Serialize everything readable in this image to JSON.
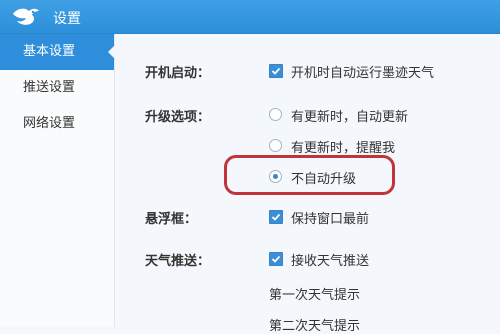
{
  "window": {
    "title": "设置",
    "logo": "bird-logo-icon"
  },
  "sidebar": {
    "items": [
      {
        "label": "基本设置",
        "active": true
      },
      {
        "label": "推送设置",
        "active": false
      },
      {
        "label": "网络设置",
        "active": false
      }
    ]
  },
  "settings": {
    "startup": {
      "label": "开机启动：",
      "option": {
        "text": "开机时自动运行墨迹天气",
        "checked": true
      }
    },
    "upgrade": {
      "label": "升级选项：",
      "options": [
        {
          "text": "有更新时，自动更新",
          "selected": false
        },
        {
          "text": "有更新时，提醒我",
          "selected": false
        },
        {
          "text": "不自动升级",
          "selected": true
        }
      ]
    },
    "floating": {
      "label": "悬浮框：",
      "option": {
        "text": "保持窗口最前",
        "checked": true
      }
    },
    "weather_push": {
      "label": "天气推送：",
      "option": {
        "text": "接收天气推送",
        "checked": true
      },
      "first_prompt": "第一次天气提示",
      "second_prompt": "第二次天气提示"
    }
  },
  "colors": {
    "titlebar": "#2d8fd9",
    "active_nav": "#2f8edb",
    "highlight_border": "#c0353a"
  }
}
